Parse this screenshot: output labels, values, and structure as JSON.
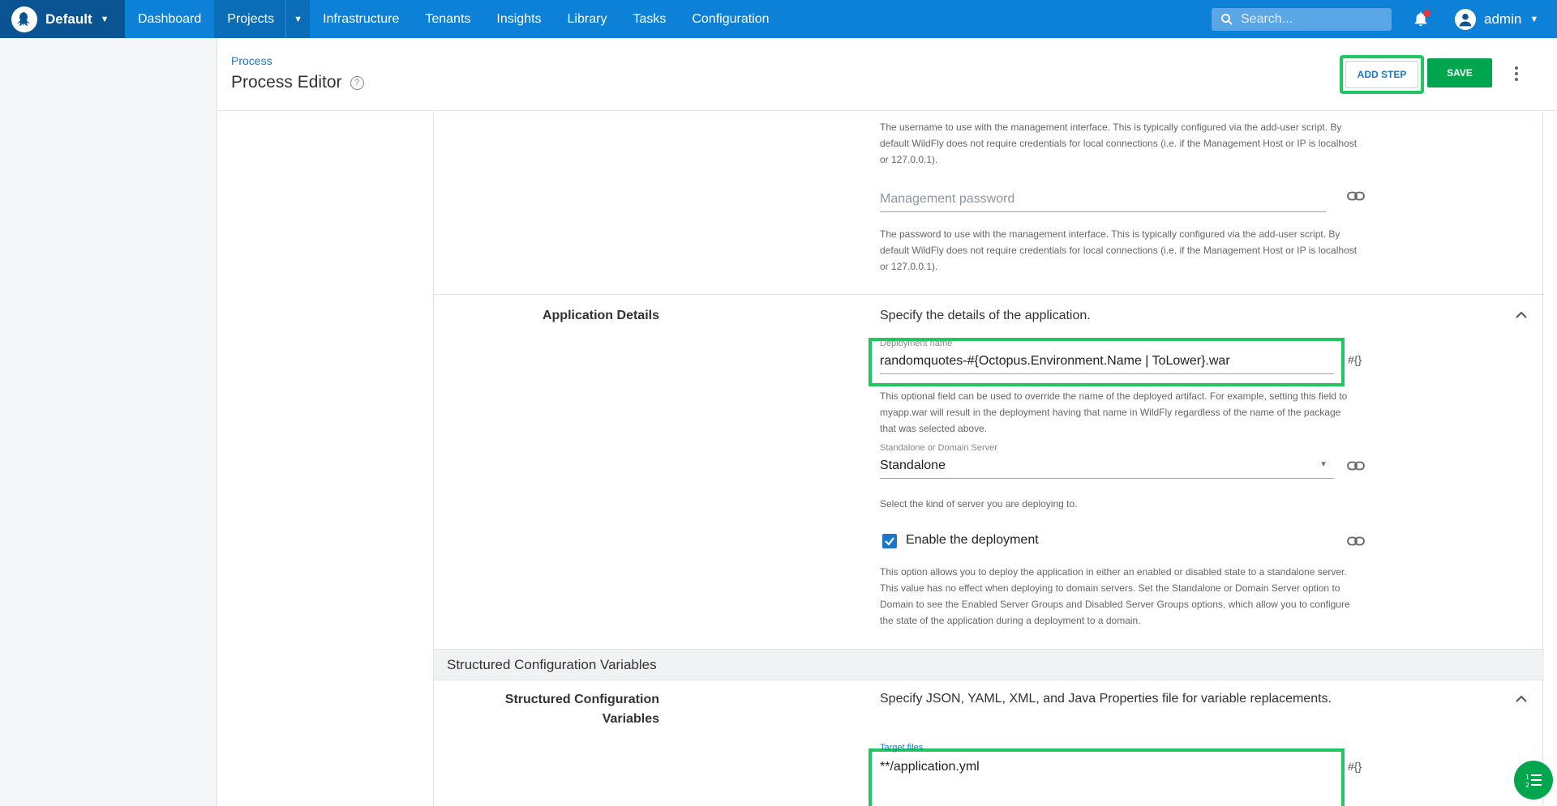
{
  "topnav": {
    "space_name": "Default",
    "items": [
      "Dashboard",
      "Projects",
      "Infrastructure",
      "Tenants",
      "Insights",
      "Library",
      "Tasks",
      "Configuration"
    ],
    "search_placeholder": "Search...",
    "user_name": "admin"
  },
  "header": {
    "breadcrumb": "Process",
    "title": "Process Editor",
    "add_step_label": "ADD STEP",
    "save_label": "SAVE"
  },
  "management_user": {
    "help": "The username to use with the management interface. This is typically configured via the add-user script. By default WildFly does not require credentials for local connections (i.e. if the Management Host or IP is localhost or 127.0.0.1)."
  },
  "management_password": {
    "placeholder": "Management password",
    "help": "The password to use with the management interface. This is typically configured via the add-user script. By default WildFly does not require credentials for local connections (i.e. if the Management Host or IP is localhost or 127.0.0.1)."
  },
  "application_details": {
    "label": "Application Details",
    "description": "Specify the details of the application.",
    "deployment_name_label": "Deployment name",
    "deployment_name_value": "randomquotes-#{Octopus.Environment.Name | ToLower}.war",
    "deployment_name_help": "This optional field can be used to override the name of the deployed artifact. For example, setting this field to myapp.war will result in the deployment having that name in WildFly regardless of the name of the package that was selected above.",
    "server_label": "Standalone or Domain Server",
    "server_value": "Standalone",
    "server_help": "Select the kind of server you are deploying to.",
    "enable_label": "Enable the deployment",
    "enable_help": "This option allows you to deploy the application in either an enabled or disabled state to a standalone server. This value has no effect when deploying to domain servers. Set the Standalone or Domain Server option to Domain to see the Enabled Server Groups and Disabled Server Groups options, which allow you to configure the state of the application during a deployment to a domain."
  },
  "structured_config": {
    "band_title": "Structured Configuration Variables",
    "label": "Structured Configuration Variables",
    "description": "Specify JSON, YAML, XML, and Java Properties file for variable replacements.",
    "target_files_label": "Target files",
    "target_files_value": "**/application.yml"
  },
  "hash_symbol": "#{}",
  "colors": {
    "nav_bg": "#0d80d8",
    "space_bg": "#0b5493",
    "accent_green": "#00a64d",
    "highlight_green": "#1fc662",
    "link_blue": "#1a77ca"
  }
}
